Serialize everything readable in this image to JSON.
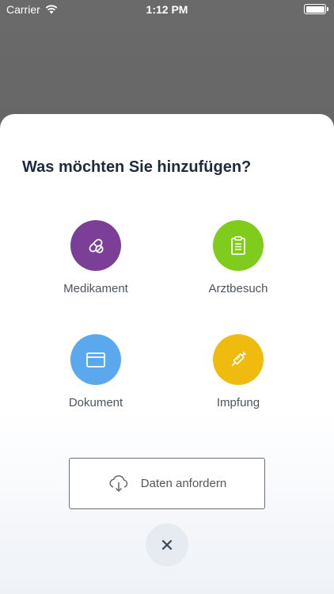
{
  "status_bar": {
    "carrier": "Carrier",
    "time": "1:12 PM"
  },
  "sheet": {
    "title": "Was möchten Sie hinzufügen?",
    "options": [
      {
        "label": "Medikament",
        "color": "#7b3f98",
        "icon": "pill-icon"
      },
      {
        "label": "Arztbesuch",
        "color": "#7fcc1c",
        "icon": "clipboard-icon"
      },
      {
        "label": "Dokument",
        "color": "#5aa9ef",
        "icon": "folder-icon"
      },
      {
        "label": "Impfung",
        "color": "#efbb0f",
        "icon": "syringe-icon"
      }
    ],
    "request_button": {
      "label": "Daten anfordern",
      "icon": "cloud-download-icon"
    },
    "close_button": {
      "icon": "close-icon"
    }
  }
}
